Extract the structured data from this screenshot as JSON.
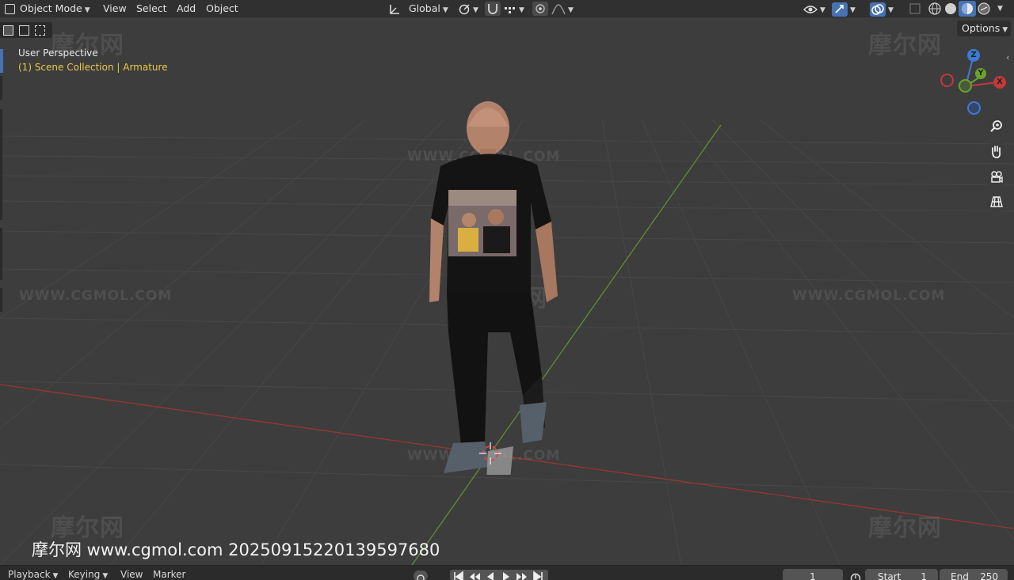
{
  "header": {
    "mode_label": "Object Mode",
    "menu": [
      "View",
      "Select",
      "Add",
      "Object"
    ],
    "transform_orientation": "Global",
    "options_label": "Options"
  },
  "viewport": {
    "view_name": "User Perspective",
    "collection_info": "(1) Scene Collection | Armature",
    "gizmo": {
      "z": "Z",
      "y": "Y",
      "x": "X"
    }
  },
  "watermark": {
    "site_logo": "摩尔网",
    "site_url": "WWW.CGMOL.COM",
    "caption": "摩尔网 www.cgmol.com 20250915220139597680"
  },
  "timeline": {
    "playback_label": "Playback",
    "keying_label": "Keying",
    "view_label": "View",
    "marker_label": "Marker",
    "current_frame": "1",
    "start_label": "Start",
    "start_value": "1",
    "end_label": "End",
    "end_value": "250"
  },
  "colors": {
    "header_bg": "#303030",
    "viewport_bg": "#3d3d3d",
    "x_axis": "#c23a3a",
    "y_axis": "#6aa32c",
    "z_axis": "#3d7ad6",
    "collection_text": "#e8c84a"
  }
}
